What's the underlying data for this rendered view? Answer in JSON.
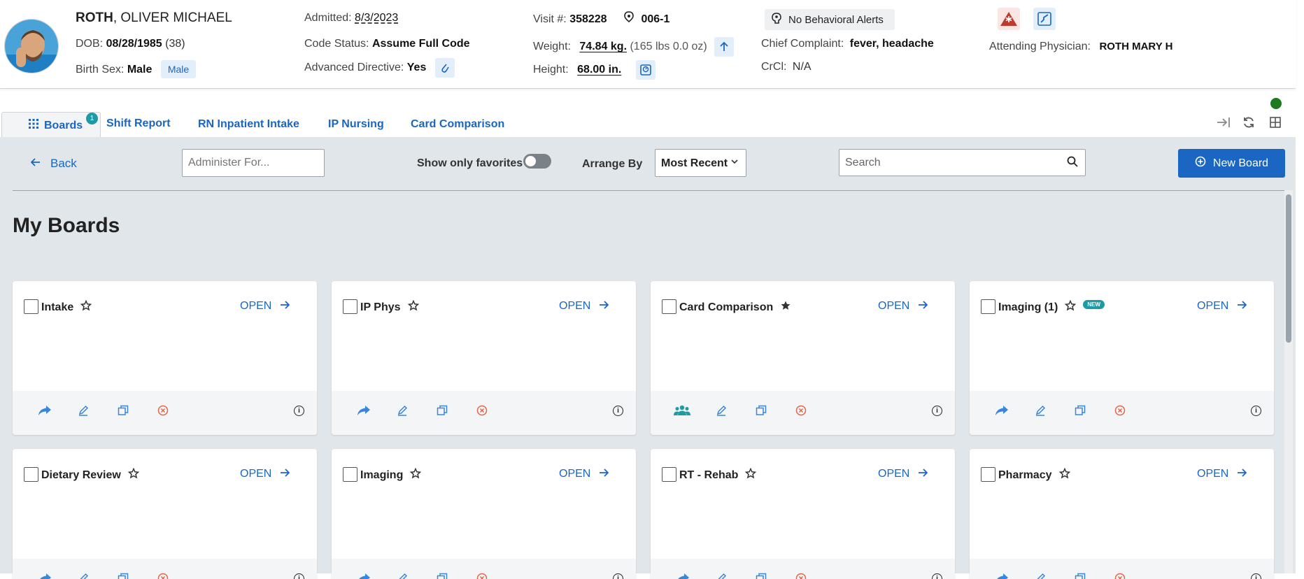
{
  "patient": {
    "last_name": "ROTH",
    "first_names": ", OLIVER MICHAEL",
    "dob_label": "DOB:",
    "dob": "08/28/1985",
    "age": "(38)",
    "sex_label": "Birth Sex:",
    "sex": "Male",
    "sex_pill": "Male",
    "admitted_label": "Admitted:",
    "admitted": "8/3/2023",
    "code_label": "Code Status:",
    "code": "Assume Full Code",
    "directive_label": "Advanced Directive:",
    "directive": "Yes",
    "visit_label": "Visit #:",
    "visit": "358228",
    "room": "006-1",
    "weight_label": "Weight:",
    "weight": "74.84 kg.",
    "weight_lbs": "(165 lbs 0.0 oz)",
    "height_label": "Height:",
    "height": "68.00 in.",
    "behavioral": "No Behavioral Alerts",
    "complaint_label": "Chief Complaint:",
    "complaint": "fever, headache",
    "crcl_label": "CrCl:",
    "crcl": "N/A",
    "physician_label": "Attending Physician:",
    "physician": "ROTH MARY H"
  },
  "tabs": {
    "boards": "Boards",
    "boards_count": "1",
    "items": [
      "Shift Report",
      "RN Inpatient Intake",
      "IP Nursing",
      "Card Comparison"
    ]
  },
  "toolbar": {
    "back": "Back",
    "administer_placeholder": "Administer For...",
    "favorites_label": "Show only favorites",
    "favorites_on": false,
    "arrange_label": "Arrange By",
    "arrange_value": "Most Recent",
    "search_placeholder": "Search",
    "new_board": "New Board"
  },
  "page_title": "My Boards",
  "open_label": "OPEN",
  "new_tag": "NEW",
  "boards": [
    {
      "name": "Intake",
      "favorite": false,
      "shared": false,
      "is_new": false
    },
    {
      "name": "IP Phys",
      "favorite": false,
      "shared": false,
      "is_new": false
    },
    {
      "name": "Card Comparison",
      "favorite": true,
      "shared": true,
      "is_new": false
    },
    {
      "name": "Imaging (1)",
      "favorite": false,
      "shared": false,
      "is_new": true
    },
    {
      "name": "Dietary Review",
      "favorite": false,
      "shared": false,
      "is_new": false
    },
    {
      "name": "Imaging",
      "favorite": false,
      "shared": false,
      "is_new": false
    },
    {
      "name": "RT - Rehab",
      "favorite": false,
      "shared": false,
      "is_new": false
    },
    {
      "name": "Pharmacy",
      "favorite": false,
      "shared": false,
      "is_new": false
    }
  ],
  "colors": {
    "primary": "#1a66c2",
    "teal": "#1c9aa6",
    "delete": "#e0664a",
    "online": "#1f7a1f",
    "alert_red": "#c0392b"
  },
  "icons": {
    "share": "share-icon",
    "shared_users": "users-icon",
    "edit": "pencil-icon",
    "copy": "copy-icon",
    "delete": "delete-circle-icon",
    "info": "info-icon"
  }
}
